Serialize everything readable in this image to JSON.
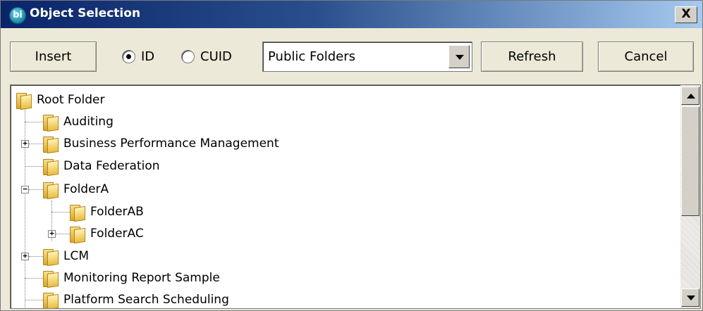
{
  "window": {
    "title": "Object Selection",
    "app_icon_text": "bi",
    "close_glyph": "X",
    "colors": {
      "titlebar_start": "#0a246a",
      "titlebar_end": "#a6caf0",
      "background": "#ece9d8"
    }
  },
  "toolbar": {
    "insert_label": "Insert",
    "radio_id_label": "ID",
    "radio_cuid_label": "CUID",
    "selected_radio": "ID",
    "folder_scope": "Public Folders",
    "refresh_label": "Refresh",
    "cancel_label": "Cancel"
  },
  "tree": {
    "root": "Root Folder",
    "nodes": [
      {
        "label": "Auditing",
        "expander": "none"
      },
      {
        "label": "Business Performance Management",
        "expander": "plus"
      },
      {
        "label": "Data Federation",
        "expander": "none"
      },
      {
        "label": "FolderA",
        "expander": "minus"
      },
      {
        "label": "FolderAB",
        "expander": "none",
        "level": 2
      },
      {
        "label": "FolderAC",
        "expander": "plus",
        "level": 2
      },
      {
        "label": "LCM",
        "expander": "plus"
      },
      {
        "label": "Monitoring Report Sample",
        "expander": "none"
      },
      {
        "label": "Platform Search Scheduling",
        "expander": "none"
      }
    ]
  },
  "icons": {
    "app": "bi-logo-icon",
    "folder": "folder-icon",
    "expand": "plus-box-icon",
    "collapse": "minus-box-icon",
    "dropdown": "chevron-down-icon",
    "scroll_up": "arrow-up-icon",
    "scroll_down": "arrow-down-icon"
  }
}
